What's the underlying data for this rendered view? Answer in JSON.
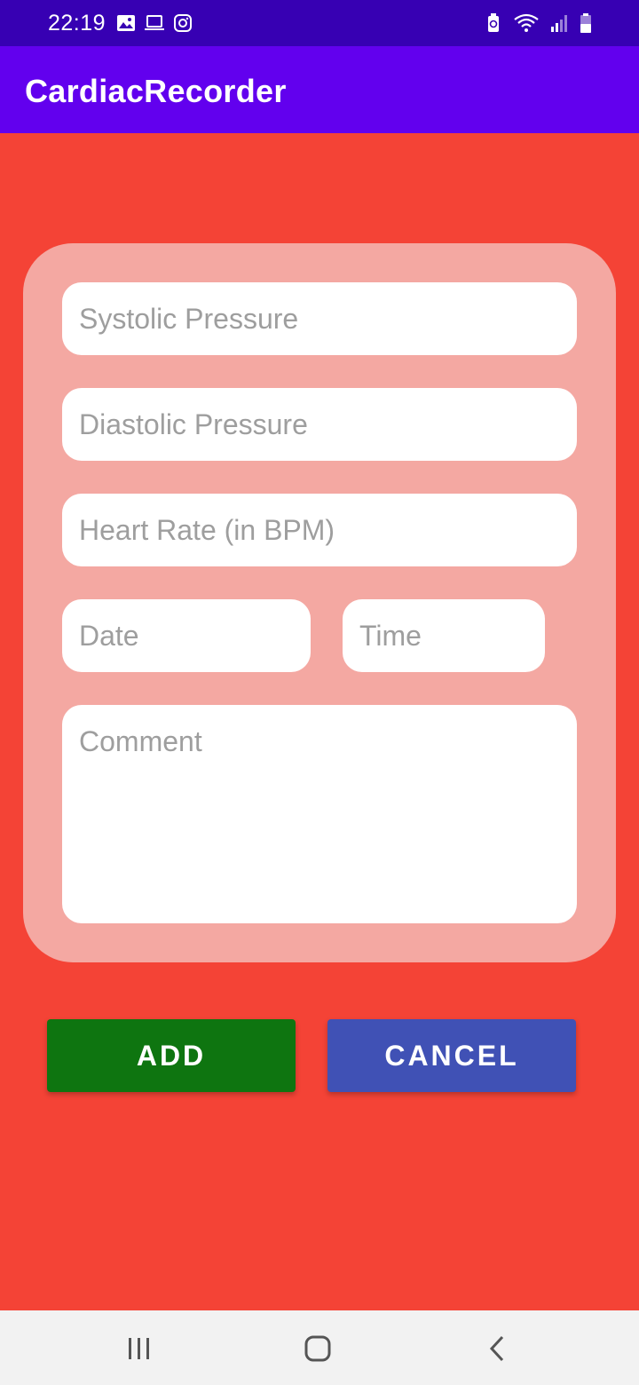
{
  "status_bar": {
    "time": "22:19",
    "left_icons": [
      "gallery-icon",
      "laptop-icon",
      "instagram-icon"
    ],
    "right_icons": [
      "battery-saver-icon",
      "wifi-icon",
      "signal-icon",
      "battery-icon"
    ]
  },
  "app_bar": {
    "title": "CardiacRecorder"
  },
  "form": {
    "systolic_placeholder": "Systolic Pressure",
    "diastolic_placeholder": "Diastolic Pressure",
    "heart_rate_placeholder": "Heart Rate (in BPM)",
    "date_placeholder": "Date",
    "time_placeholder": "Time",
    "comment_placeholder": "Comment"
  },
  "buttons": {
    "add_label": "ADD",
    "cancel_label": "CANCEL"
  },
  "nav_bar": {
    "icons": [
      "recent-apps-icon",
      "home-icon",
      "back-icon"
    ]
  },
  "colors": {
    "status_bar": "#3700b3",
    "app_bar": "#6200ee",
    "background": "#f44336",
    "card": "#f4a8a2",
    "add_button": "#0e7510",
    "cancel_button": "#4051b5"
  }
}
